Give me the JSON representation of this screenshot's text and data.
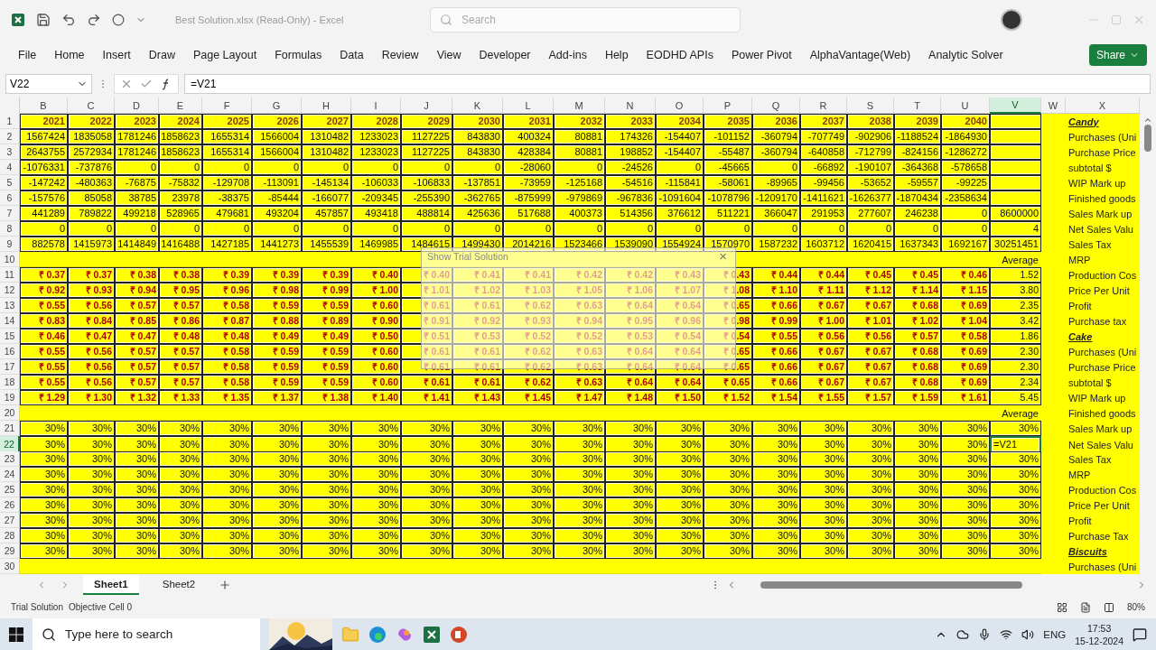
{
  "title_bar": {
    "file_title": "Best Solution.xlsx (Read-Only) - Excel",
    "search": {
      "placeholder": "Search"
    }
  },
  "menu": [
    "File",
    "Home",
    "Insert",
    "Draw",
    "Page Layout",
    "Formulas",
    "Data",
    "Review",
    "View",
    "Developer",
    "Add-ins",
    "Help",
    "EODHD APIs",
    "Power Pivot",
    "AlphaVantage(Web)",
    "Analytic Solver"
  ],
  "share_button": "Share",
  "formula_bar": {
    "name_box": "V22",
    "formula": "=V21"
  },
  "columns": [
    {
      "label": "B",
      "selected": false
    },
    {
      "label": "C",
      "selected": false
    },
    {
      "label": "D",
      "selected": false
    },
    {
      "label": "E",
      "selected": false
    },
    {
      "label": "F",
      "selected": false
    },
    {
      "label": "G",
      "selected": false
    },
    {
      "label": "H",
      "selected": false
    },
    {
      "label": "I",
      "selected": false
    },
    {
      "label": "J",
      "selected": false
    },
    {
      "label": "K",
      "selected": false
    },
    {
      "label": "L",
      "selected": false
    },
    {
      "label": "M",
      "selected": false
    },
    {
      "label": "N",
      "selected": false
    },
    {
      "label": "O",
      "selected": false
    },
    {
      "label": "P",
      "selected": false
    },
    {
      "label": "Q",
      "selected": false
    },
    {
      "label": "R",
      "selected": false
    },
    {
      "label": "S",
      "selected": false
    },
    {
      "label": "T",
      "selected": false
    },
    {
      "label": "U",
      "selected": false
    },
    {
      "label": "V",
      "selected": true
    },
    {
      "label": "W",
      "selected": false
    },
    {
      "label": "X",
      "selected": false
    }
  ],
  "rows": [
    {
      "number": "1",
      "kind": "year",
      "selected": false,
      "cells": [
        "2021",
        "2022",
        "2023",
        "2024",
        "2025",
        "2026",
        "2027",
        "2028",
        "2029",
        "2030",
        "2031",
        "2032",
        "2033",
        "2034",
        "2035",
        "2036",
        "2037",
        "2038",
        "2039",
        "2040"
      ],
      "label": "Candy",
      "heading": true
    },
    {
      "number": "2",
      "kind": "number",
      "selected": false,
      "cells": [
        "1567424",
        "1835058",
        "1781246",
        "1858623",
        "1655314",
        "1566004",
        "1310482",
        "1233023",
        "1127225",
        "843830",
        "400324",
        "80881",
        "174326",
        "-154407",
        "-101152",
        "-360794",
        "-707749",
        "-902906",
        "-1188524",
        "-1864930"
      ],
      "label": "Purchases (Uni",
      "heading": false
    },
    {
      "number": "3",
      "kind": "number",
      "selected": false,
      "cells": [
        "2643755",
        "2572934",
        "1781246",
        "1858623",
        "1655314",
        "1566004",
        "1310482",
        "1233023",
        "1127225",
        "843830",
        "428384",
        "80881",
        "198852",
        "-154407",
        "-55487",
        "-360794",
        "-640858",
        "-712799",
        "-824156",
        "-1286272"
      ],
      "label": "Purchase Price",
      "heading": false
    },
    {
      "number": "4",
      "kind": "number",
      "selected": false,
      "cells": [
        "-1076331",
        "-737876",
        "0",
        "0",
        "0",
        "0",
        "0",
        "0",
        "0",
        "0",
        "-28060",
        "0",
        "-24526",
        "0",
        "-45665",
        "0",
        "-66892",
        "-190107",
        "-364368",
        "-578658"
      ],
      "label": "subtotal $",
      "heading": false
    },
    {
      "number": "5",
      "kind": "number",
      "selected": false,
      "cells": [
        "-147242",
        "-480363",
        "-76875",
        "-75832",
        "-129708",
        "-113091",
        "-145134",
        "-106033",
        "-106833",
        "-137851",
        "-73959",
        "-125168",
        "-54516",
        "-115841",
        "-58061",
        "-89965",
        "-99456",
        "-53652",
        "-59557",
        "-99225"
      ],
      "label": "WIP Mark up",
      "heading": false
    },
    {
      "number": "6",
      "kind": "number",
      "selected": false,
      "cells": [
        "-157576",
        "85058",
        "38785",
        "23978",
        "-38375",
        "-85444",
        "-166077",
        "-209345",
        "-255390",
        "-362765",
        "-875999",
        "-979869",
        "-967836",
        "-1091604",
        "-1078796",
        "-1209170",
        "-1411621",
        "-1626377",
        "-1870434",
        "-2358634"
      ],
      "label": "Finished goods",
      "heading": false
    },
    {
      "number": "7",
      "kind": "number",
      "selected": false,
      "cells": [
        "441289",
        "789822",
        "499218",
        "528965",
        "479681",
        "493204",
        "457857",
        "493418",
        "488814",
        "425636",
        "517688",
        "400373",
        "514356",
        "376612",
        "511221",
        "366047",
        "291953",
        "277607",
        "246238",
        "0"
      ],
      "total": "8600000",
      "label": "Sales Mark up",
      "heading": false
    },
    {
      "number": "8",
      "kind": "number",
      "selected": false,
      "cells": [
        "0",
        "0",
        "0",
        "0",
        "0",
        "0",
        "0",
        "0",
        "0",
        "0",
        "0",
        "0",
        "0",
        "0",
        "0",
        "0",
        "0",
        "0",
        "0",
        "0"
      ],
      "total": "4",
      "label": "Net Sales Valu",
      "heading": false
    },
    {
      "number": "9",
      "kind": "number",
      "selected": false,
      "cells": [
        "882578",
        "1415973",
        "1414849",
        "1416488",
        "1427185",
        "1441273",
        "1455539",
        "1469985",
        "1484615",
        "1499430",
        "2014216",
        "1523466",
        "1539090",
        "1554924",
        "1570970",
        "1587232",
        "1603712",
        "1620415",
        "1637343",
        "1692167"
      ],
      "total": "30251451",
      "label": "Sales Tax",
      "heading": false
    },
    {
      "number": "10",
      "kind": "spacer",
      "selected": false,
      "total": "Average",
      "label": "MRP",
      "heading": false
    },
    {
      "number": "11",
      "kind": "currency",
      "selected": false,
      "cells": [
        "₹ 0.37",
        "₹ 0.37",
        "₹ 0.38",
        "₹ 0.38",
        "₹ 0.39",
        "₹ 0.39",
        "₹ 0.39",
        "₹ 0.40",
        "₹ 0.40",
        "₹ 0.41",
        "₹ 0.41",
        "₹ 0.42",
        "₹ 0.42",
        "₹ 0.43",
        "₹ 0.43",
        "₹ 0.44",
        "₹ 0.44",
        "₹ 0.45",
        "₹ 0.45",
        "₹ 0.46"
      ],
      "total": "1.52",
      "label": "Production Cos",
      "heading": false
    },
    {
      "number": "12",
      "kind": "currency",
      "selected": false,
      "cells": [
        "₹ 0.92",
        "₹ 0.93",
        "₹ 0.94",
        "₹ 0.95",
        "₹ 0.96",
        "₹ 0.98",
        "₹ 0.99",
        "₹ 1.00",
        "₹ 1.01",
        "₹ 1.02",
        "₹ 1.03",
        "₹ 1.05",
        "₹ 1.06",
        "₹ 1.07",
        "₹ 1.08",
        "₹ 1.10",
        "₹ 1.11",
        "₹ 1.12",
        "₹ 1.14",
        "₹ 1.15"
      ],
      "total": "3.80",
      "label": "Price Per Unit",
      "heading": false
    },
    {
      "number": "13",
      "kind": "currency",
      "selected": false,
      "cells": [
        "₹ 0.55",
        "₹ 0.56",
        "₹ 0.57",
        "₹ 0.57",
        "₹ 0.58",
        "₹ 0.59",
        "₹ 0.59",
        "₹ 0.60",
        "₹ 0.61",
        "₹ 0.61",
        "₹ 0.62",
        "₹ 0.63",
        "₹ 0.64",
        "₹ 0.64",
        "₹ 0.65",
        "₹ 0.66",
        "₹ 0.67",
        "₹ 0.67",
        "₹ 0.68",
        "₹ 0.69"
      ],
      "total": "2.35",
      "label": "Profit",
      "heading": false
    },
    {
      "number": "14",
      "kind": "currency",
      "selected": false,
      "cells": [
        "₹ 0.83",
        "₹ 0.84",
        "₹ 0.85",
        "₹ 0.86",
        "₹ 0.87",
        "₹ 0.88",
        "₹ 0.89",
        "₹ 0.90",
        "₹ 0.91",
        "₹ 0.92",
        "₹ 0.93",
        "₹ 0.94",
        "₹ 0.95",
        "₹ 0.96",
        "₹ 0.98",
        "₹ 0.99",
        "₹ 1.00",
        "₹ 1.01",
        "₹ 1.02",
        "₹ 1.04"
      ],
      "total": "3.42",
      "label": "Purchase tax",
      "heading": false
    },
    {
      "number": "15",
      "kind": "currency",
      "selected": false,
      "cells": [
        "₹ 0.46",
        "₹ 0.47",
        "₹ 0.47",
        "₹ 0.48",
        "₹ 0.48",
        "₹ 0.49",
        "₹ 0.49",
        "₹ 0.50",
        "₹ 0.51",
        "₹ 0.53",
        "₹ 0.52",
        "₹ 0.52",
        "₹ 0.53",
        "₹ 0.54",
        "₹ 0.54",
        "₹ 0.55",
        "₹ 0.56",
        "₹ 0.56",
        "₹ 0.57",
        "₹ 0.58"
      ],
      "total": "1.86",
      "label": "Cake",
      "heading": true
    },
    {
      "number": "16",
      "kind": "currency",
      "selected": false,
      "cells": [
        "₹ 0.55",
        "₹ 0.56",
        "₹ 0.57",
        "₹ 0.57",
        "₹ 0.58",
        "₹ 0.59",
        "₹ 0.59",
        "₹ 0.60",
        "₹ 0.61",
        "₹ 0.61",
        "₹ 0.62",
        "₹ 0.63",
        "₹ 0.64",
        "₹ 0.64",
        "₹ 0.65",
        "₹ 0.66",
        "₹ 0.67",
        "₹ 0.67",
        "₹ 0.68",
        "₹ 0.69"
      ],
      "total": "2.30",
      "label": "Purchases (Uni",
      "heading": false
    },
    {
      "number": "17",
      "kind": "currency",
      "selected": false,
      "cells": [
        "₹ 0.55",
        "₹ 0.56",
        "₹ 0.57",
        "₹ 0.57",
        "₹ 0.58",
        "₹ 0.59",
        "₹ 0.59",
        "₹ 0.60",
        "₹ 0.61",
        "₹ 0.61",
        "₹ 0.62",
        "₹ 0.63",
        "₹ 0.64",
        "₹ 0.64",
        "₹ 0.65",
        "₹ 0.66",
        "₹ 0.67",
        "₹ 0.67",
        "₹ 0.68",
        "₹ 0.69"
      ],
      "total": "2.30",
      "label": "Purchase Price",
      "heading": false
    },
    {
      "number": "18",
      "kind": "currency",
      "selected": false,
      "cells": [
        "₹ 0.55",
        "₹ 0.56",
        "₹ 0.57",
        "₹ 0.57",
        "₹ 0.58",
        "₹ 0.59",
        "₹ 0.59",
        "₹ 0.60",
        "₹ 0.61",
        "₹ 0.61",
        "₹ 0.62",
        "₹ 0.63",
        "₹ 0.64",
        "₹ 0.64",
        "₹ 0.65",
        "₹ 0.66",
        "₹ 0.67",
        "₹ 0.67",
        "₹ 0.68",
        "₹ 0.69"
      ],
      "total": "2.34",
      "label": "subtotal $",
      "heading": false
    },
    {
      "number": "19",
      "kind": "currency",
      "selected": false,
      "cells": [
        "₹ 1.29",
        "₹ 1.30",
        "₹ 1.32",
        "₹ 1.33",
        "₹ 1.35",
        "₹ 1.37",
        "₹ 1.38",
        "₹ 1.40",
        "₹ 1.41",
        "₹ 1.43",
        "₹ 1.45",
        "₹ 1.47",
        "₹ 1.48",
        "₹ 1.50",
        "₹ 1.52",
        "₹ 1.54",
        "₹ 1.55",
        "₹ 1.57",
        "₹ 1.59",
        "₹ 1.61"
      ],
      "total": "5.45",
      "label": "WIP Mark up",
      "heading": false
    },
    {
      "number": "20",
      "kind": "spacer",
      "selected": false,
      "total": "Average",
      "label": "Finished goods",
      "heading": false
    },
    {
      "number": "21",
      "kind": "percent",
      "selected": false,
      "cells": [
        "30%",
        "30%",
        "30%",
        "30%",
        "30%",
        "30%",
        "30%",
        "30%",
        "30%",
        "30%",
        "30%",
        "30%",
        "30%",
        "30%",
        "30%",
        "30%",
        "30%",
        "30%",
        "30%",
        "30%"
      ],
      "total": "30%",
      "label": "Sales Mark up",
      "heading": false
    },
    {
      "number": "22",
      "kind": "percent",
      "selected": true,
      "cells": [
        "30%",
        "30%",
        "30%",
        "30%",
        "30%",
        "30%",
        "30%",
        "30%",
        "30%",
        "30%",
        "30%",
        "30%",
        "30%",
        "30%",
        "30%",
        "30%",
        "30%",
        "30%",
        "30%",
        "30%"
      ],
      "total": "=V21",
      "label": "Net Sales Valu",
      "heading": false
    },
    {
      "number": "23",
      "kind": "percent",
      "selected": false,
      "cells": [
        "30%",
        "30%",
        "30%",
        "30%",
        "30%",
        "30%",
        "30%",
        "30%",
        "30%",
        "30%",
        "30%",
        "30%",
        "30%",
        "30%",
        "30%",
        "30%",
        "30%",
        "30%",
        "30%",
        "30%"
      ],
      "total": "30%",
      "label": "Sales Tax",
      "heading": false
    },
    {
      "number": "24",
      "kind": "percent",
      "selected": false,
      "cells": [
        "30%",
        "30%",
        "30%",
        "30%",
        "30%",
        "30%",
        "30%",
        "30%",
        "30%",
        "30%",
        "30%",
        "30%",
        "30%",
        "30%",
        "30%",
        "30%",
        "30%",
        "30%",
        "30%",
        "30%"
      ],
      "total": "30%",
      "label": "MRP",
      "heading": false
    },
    {
      "number": "25",
      "kind": "percent",
      "selected": false,
      "cells": [
        "30%",
        "30%",
        "30%",
        "30%",
        "30%",
        "30%",
        "30%",
        "30%",
        "30%",
        "30%",
        "30%",
        "30%",
        "30%",
        "30%",
        "30%",
        "30%",
        "30%",
        "30%",
        "30%",
        "30%"
      ],
      "total": "30%",
      "label": "Production Cos",
      "heading": false
    },
    {
      "number": "26",
      "kind": "percent",
      "selected": false,
      "cells": [
        "30%",
        "30%",
        "30%",
        "30%",
        "30%",
        "30%",
        "30%",
        "30%",
        "30%",
        "30%",
        "30%",
        "30%",
        "30%",
        "30%",
        "30%",
        "30%",
        "30%",
        "30%",
        "30%",
        "30%"
      ],
      "total": "30%",
      "label": "Price Per Unit",
      "heading": false
    },
    {
      "number": "27",
      "kind": "percent",
      "selected": false,
      "cells": [
        "30%",
        "30%",
        "30%",
        "30%",
        "30%",
        "30%",
        "30%",
        "30%",
        "30%",
        "30%",
        "30%",
        "30%",
        "30%",
        "30%",
        "30%",
        "30%",
        "30%",
        "30%",
        "30%",
        "30%"
      ],
      "total": "30%",
      "label": "Profit",
      "heading": false
    },
    {
      "number": "28",
      "kind": "percent",
      "selected": false,
      "cells": [
        "30%",
        "30%",
        "30%",
        "30%",
        "30%",
        "30%",
        "30%",
        "30%",
        "30%",
        "30%",
        "30%",
        "30%",
        "30%",
        "30%",
        "30%",
        "30%",
        "30%",
        "30%",
        "30%",
        "30%"
      ],
      "total": "30%",
      "label": "Purchase Tax",
      "heading": false
    },
    {
      "number": "29",
      "kind": "percent",
      "selected": false,
      "cells": [
        "30%",
        "30%",
        "30%",
        "30%",
        "30%",
        "30%",
        "30%",
        "30%",
        "30%",
        "30%",
        "30%",
        "30%",
        "30%",
        "30%",
        "30%",
        "30%",
        "30%",
        "30%",
        "30%",
        "30%"
      ],
      "total": "30%",
      "label": "Biscuits",
      "heading": true
    },
    {
      "number": "30",
      "kind": "spacer",
      "selected": false,
      "label": "Purchases (Uni",
      "heading": false
    }
  ],
  "dialog": {
    "title": "Show Trial Solution",
    "close": "×"
  },
  "sheet_tabs": [
    {
      "label": "Sheet1",
      "selected": true
    },
    {
      "label": "Sheet2",
      "selected": false
    }
  ],
  "status_bar": {
    "left": "Trial Solution",
    "objective": "Objective Cell 0",
    "zoom": "80%"
  },
  "taskbar": {
    "search": {
      "placeholder": "Type here to search"
    },
    "language": "ENG",
    "time": "17:53",
    "date": "15-12-2024"
  }
}
